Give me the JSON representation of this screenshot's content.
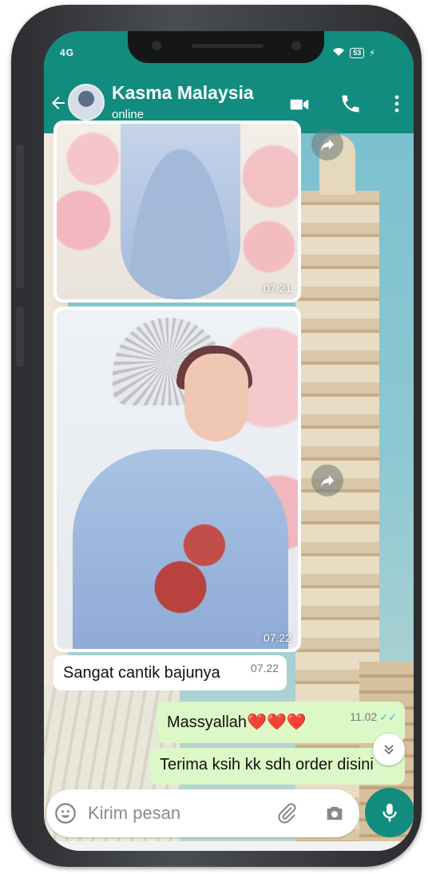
{
  "status_bar": {
    "left_text": "4G",
    "battery": "53"
  },
  "header": {
    "contact_name": "Kasma Malaysia",
    "status": "online",
    "icons": [
      "back-arrow-icon",
      "video-call-icon",
      "voice-call-icon",
      "more-vertical-icon"
    ]
  },
  "messages": [
    {
      "type": "image",
      "direction": "in",
      "time": "07.21"
    },
    {
      "type": "image",
      "direction": "in",
      "time": "07.22"
    },
    {
      "type": "text",
      "direction": "in",
      "text": "Sangat cantik bajunya",
      "time": "07.22"
    },
    {
      "type": "text",
      "direction": "out",
      "text": "Massyallah❤️❤️❤️",
      "time": "11.02",
      "status": "read"
    },
    {
      "type": "text",
      "direction": "out",
      "text": "Terima ksih kk sdh order disini"
    }
  ],
  "composer": {
    "placeholder": "Kirim pesan",
    "icons": [
      "emoji-icon",
      "attach-icon",
      "camera-icon",
      "mic-icon"
    ]
  },
  "colors": {
    "header": "#128c7e",
    "outgoing_bubble": "#dcf8c6",
    "incoming_bubble": "#ffffff",
    "read_ticks": "#34b7f1"
  }
}
